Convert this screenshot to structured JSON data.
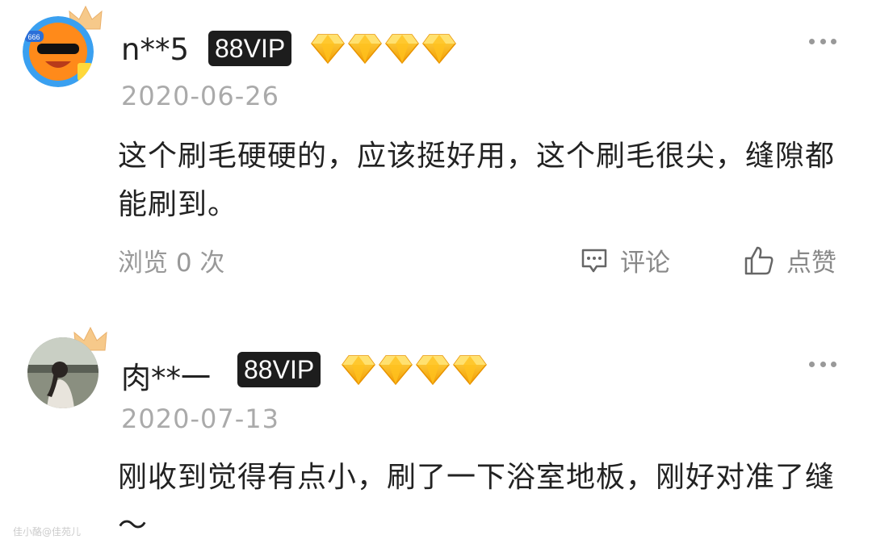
{
  "reviews": [
    {
      "username": "n**5",
      "badge": "88VIP",
      "gem_count": 4,
      "date": "2020-06-26",
      "text": "这个刷毛硬硬的，应该挺好用，这个刷毛很尖，缝隙都能刷到。",
      "views": "浏览 0 次",
      "comment_label": "评论",
      "like_label": "点赞",
      "avatar_badge": "666"
    },
    {
      "username": "肉**一",
      "badge": "88VIP",
      "gem_count": 4,
      "date": "2020-07-13",
      "text": "刚收到觉得有点小，刷了一下浴室地板，刚好对准了缝～"
    }
  ],
  "watermark": "佳小酪@佳苑儿",
  "colors": {
    "badge_bg": "#1d1d1d",
    "gem": "#f7b90f",
    "muted": "#999999"
  },
  "icons": [
    "crown-icon",
    "diamond-icon",
    "more-icon",
    "comment-icon",
    "thumbs-up-icon"
  ]
}
